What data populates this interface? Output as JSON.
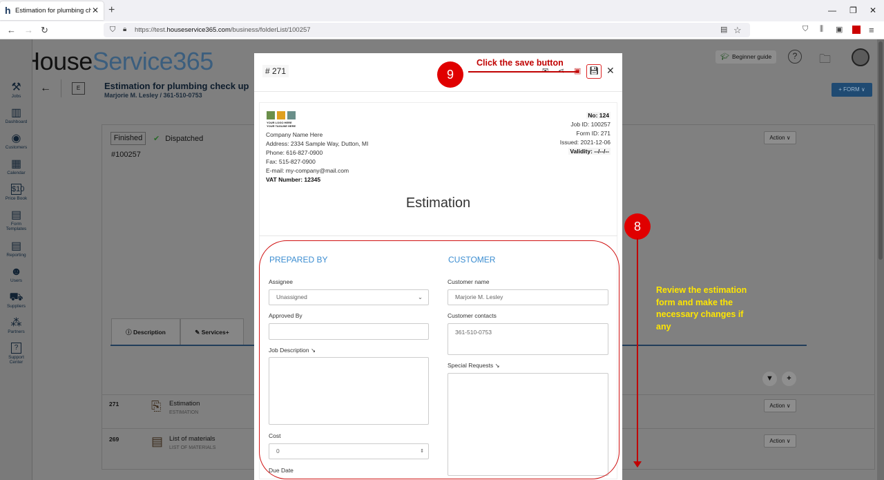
{
  "browser": {
    "tab_title": "Estimation for plumbing check",
    "url_prefix": "https://test.",
    "url_domain": "houseservice365.com",
    "url_path": "/business/folderList/100257"
  },
  "app": {
    "logo_h": "h",
    "logo_house": "House",
    "logo_service": "Service365",
    "beginner_guide": "Beginner guide",
    "page_title": "Estimation for plumbing check up",
    "page_subtitle": "Marjorie M. Lesley / 361-510-0753",
    "e_badge": "E",
    "form_button": "+ FORM ∨",
    "status_finished": "Finished",
    "status_dispatched": "Dispatched",
    "job_number": "#100257",
    "action_label": "Action ∨",
    "tabs": [
      "Description",
      "Services+"
    ],
    "rows": [
      {
        "id": "271",
        "title": "Estimation",
        "sub": "ESTIMATION"
      },
      {
        "id": "269",
        "title": "List of materials",
        "sub": "LIST OF MATERIALS"
      }
    ]
  },
  "sidebar": {
    "items": [
      {
        "label": "Jobs",
        "icon": "⚒"
      },
      {
        "label": "Dashboard",
        "icon": "▥"
      },
      {
        "label": "Customers",
        "icon": "◉"
      },
      {
        "label": "Calendar",
        "icon": "▦"
      },
      {
        "label": "Price Book",
        "icon": "$"
      },
      {
        "label": "Form",
        "label2": "Templates",
        "icon": "▤"
      },
      {
        "label": "Reporting",
        "icon": "▤"
      },
      {
        "label": "Users",
        "icon": "☻"
      },
      {
        "label": "Suppliers",
        "icon": "⛟"
      },
      {
        "label": "Partners",
        "icon": "⁂"
      },
      {
        "label": "Support",
        "label2": "Center",
        "icon": "?"
      }
    ]
  },
  "modal": {
    "number": "# 271",
    "company": {
      "logo_text1": "YOUR LOGO HERE",
      "logo_text2": "YOUR TAGLINE HERE",
      "name": "Company Name Here",
      "address": "Address: 2334 Sample Way, Dutton, MI",
      "phone": "Phone: 616-827-0900",
      "fax": "Fax: 515-827-0900",
      "email": "E-mail: my-company@mail.com",
      "vat": "VAT Number: 12345"
    },
    "meta": {
      "no": "No: 124",
      "job_id": "Job ID: 100257",
      "form_id": "Form ID: 271",
      "issued": "Issued: 2021-12-06",
      "validity": "Validity: --/--/--"
    },
    "doc_title": "Estimation",
    "prepared_by": "PREPARED BY",
    "customer": "CUSTOMER",
    "fields": {
      "assignee_label": "Assignee",
      "assignee_value": "Unassigned",
      "approved_label": "Approved By",
      "job_desc_label": "Job Description ↘",
      "cost_label": "Cost",
      "cost_value": "0",
      "due_label": "Due Date",
      "cust_name_label": "Customer name",
      "cust_name_value": "Marjorie M. Lesley",
      "cust_contacts_label": "Customer contacts",
      "cust_contacts_value": "361-510-0753",
      "special_label": "Special Requests ↘"
    }
  },
  "annotations": {
    "step9": "9",
    "step9_text": "Click the save button",
    "step8": "8",
    "step8_text": "Review the estimation form and make the necessary changes if any"
  }
}
